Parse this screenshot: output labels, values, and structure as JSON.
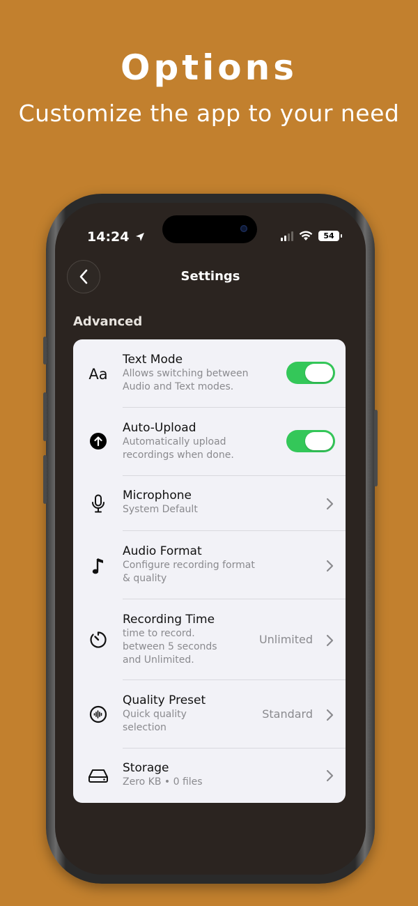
{
  "hero": {
    "title": "Options",
    "subtitle": "Customize the app to your need"
  },
  "status_bar": {
    "time": "14:24",
    "battery": "54"
  },
  "nav": {
    "title": "Settings",
    "back_icon": "chevron-left-icon"
  },
  "section": {
    "title": "Advanced"
  },
  "settings": [
    {
      "title": "Text Mode",
      "subtitle": "Allows switching between\nAudio and Text modes.",
      "icon": "text-aa-icon",
      "control": "toggle",
      "on": true
    },
    {
      "title": "Auto-Upload",
      "subtitle": "Automatically upload\nrecordings when done.",
      "icon": "upload-circle-icon",
      "control": "toggle",
      "on": true
    },
    {
      "title": "Microphone",
      "subtitle": "System Default",
      "icon": "microphone-icon",
      "control": "chevron"
    },
    {
      "title": "Audio Format",
      "subtitle": "Configure recording format\n& quality",
      "icon": "music-note-icon",
      "control": "chevron"
    },
    {
      "title": "Recording Time",
      "subtitle": "time to record.\nbetween 5 seconds\nand Unlimited.",
      "icon": "timer-icon",
      "control": "chevron",
      "value": "Unlimited"
    },
    {
      "title": "Quality Preset",
      "subtitle": "Quick quality\nselection",
      "icon": "waveform-circle-icon",
      "control": "chevron",
      "value": "Standard"
    },
    {
      "title": "Storage",
      "subtitle": "Zero KB • 0 files",
      "icon": "drive-icon",
      "control": "chevron"
    }
  ],
  "colors": {
    "background": "#c2802e",
    "screen": "#2b2420",
    "card": "#f2f2f7",
    "toggle_on": "#34c759"
  }
}
